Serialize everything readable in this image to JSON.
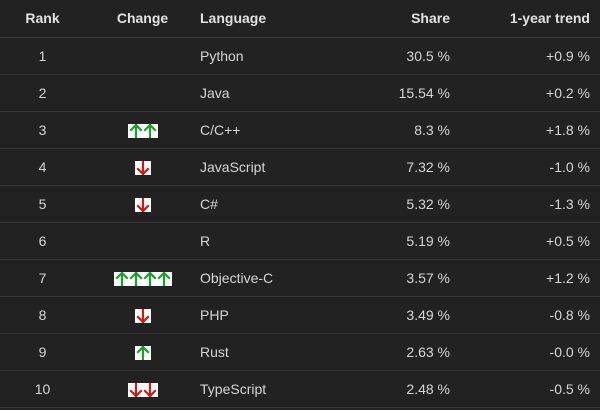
{
  "header": {
    "rank": "Rank",
    "change": "Change",
    "language": "Language",
    "share": "Share",
    "trend": "1-year trend"
  },
  "colors": {
    "up": "#1a9e2c",
    "down": "#cc1a1a",
    "background": "#222222"
  },
  "rows": [
    {
      "rank": "1",
      "change": {
        "direction": "none",
        "count": 0
      },
      "language": "Python",
      "share": "30.5 %",
      "trend": "+0.9 %"
    },
    {
      "rank": "2",
      "change": {
        "direction": "none",
        "count": 0
      },
      "language": "Java",
      "share": "15.54 %",
      "trend": "+0.2 %"
    },
    {
      "rank": "3",
      "change": {
        "direction": "up",
        "count": 2
      },
      "language": "C/C++",
      "share": "8.3 %",
      "trend": "+1.8 %"
    },
    {
      "rank": "4",
      "change": {
        "direction": "down",
        "count": 1
      },
      "language": "JavaScript",
      "share": "7.32 %",
      "trend": "-1.0 %"
    },
    {
      "rank": "5",
      "change": {
        "direction": "down",
        "count": 1
      },
      "language": "C#",
      "share": "5.32 %",
      "trend": "-1.3 %"
    },
    {
      "rank": "6",
      "change": {
        "direction": "none",
        "count": 0
      },
      "language": "R",
      "share": "5.19 %",
      "trend": "+0.5 %"
    },
    {
      "rank": "7",
      "change": {
        "direction": "up",
        "count": 4
      },
      "language": "Objective-C",
      "share": "3.57 %",
      "trend": "+1.2 %"
    },
    {
      "rank": "8",
      "change": {
        "direction": "down",
        "count": 1
      },
      "language": "PHP",
      "share": "3.49 %",
      "trend": "-0.8 %"
    },
    {
      "rank": "9",
      "change": {
        "direction": "up",
        "count": 1
      },
      "language": "Rust",
      "share": "2.63 %",
      "trend": "-0.0 %"
    },
    {
      "rank": "10",
      "change": {
        "direction": "down",
        "count": 2
      },
      "language": "TypeScript",
      "share": "2.48 %",
      "trend": "-0.5 %"
    }
  ]
}
